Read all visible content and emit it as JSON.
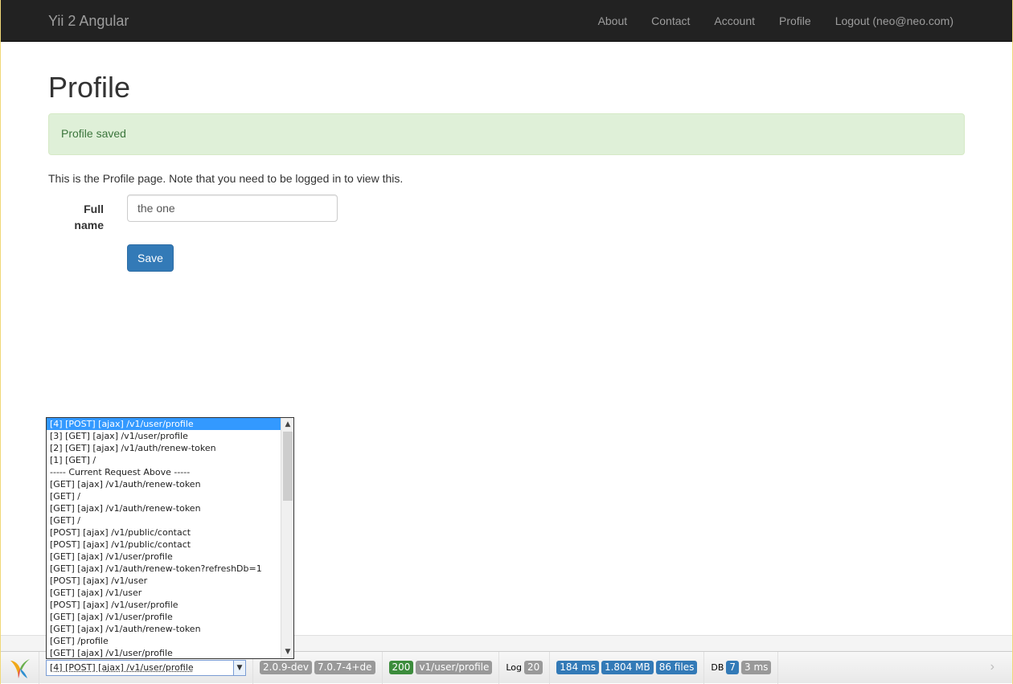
{
  "navbar": {
    "brand": "Yii 2 Angular",
    "items": [
      {
        "label": "About"
      },
      {
        "label": "Contact"
      },
      {
        "label": "Account"
      },
      {
        "label": "Profile"
      },
      {
        "label": "Logout (neo@neo.com)"
      }
    ]
  },
  "page": {
    "title": "Profile",
    "alert": "Profile saved",
    "intro": "This is the Profile page. Note that you need to be logged in to view this."
  },
  "form": {
    "fullname_label_line1": "Full",
    "fullname_label_line2": "name",
    "fullname_value": "the one",
    "save_label": "Save"
  },
  "debug_toolbar": {
    "request_selected": "[4] [POST] [ajax] /v1/user/profile",
    "yii_version": "2.0.9-dev",
    "php_version": "7.0.7-4+de",
    "status": "200",
    "route": "v1/user/profile",
    "log_label": "Log",
    "log_count": "20",
    "time": "184 ms",
    "memory": "1.804 MB",
    "files": "86 files",
    "db_label": "DB",
    "db_count": "7",
    "db_time": "3 ms",
    "colors": {
      "gray": "#999999",
      "green": "#3c8c3c",
      "blue": "#337ab7"
    }
  },
  "request_list": [
    "[4] [POST] [ajax] /v1/user/profile",
    "[3] [GET] [ajax] /v1/user/profile",
    "[2] [GET] [ajax] /v1/auth/renew-token",
    "[1] [GET] /",
    "----- Current Request Above -----",
    "[GET] [ajax] /v1/auth/renew-token",
    "[GET] /",
    "[GET] [ajax] /v1/auth/renew-token",
    "[GET] /",
    "[POST] [ajax] /v1/public/contact",
    "[POST] [ajax] /v1/public/contact",
    "[GET] [ajax] /v1/user/profile",
    "[GET] [ajax] /v1/auth/renew-token?refreshDb=1",
    "[POST] [ajax] /v1/user",
    "[GET] [ajax] /v1/user",
    "[POST] [ajax] /v1/user/profile",
    "[GET] [ajax] /v1/user/profile",
    "[GET] [ajax] /v1/auth/renew-token",
    "[GET] /profile",
    "[GET] [ajax] /v1/user/profile"
  ]
}
